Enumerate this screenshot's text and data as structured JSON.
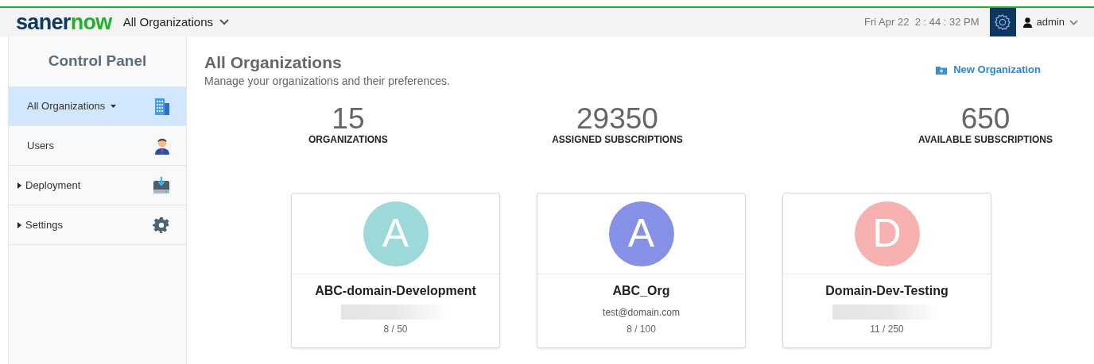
{
  "header": {
    "logo_parts": [
      "saner",
      "now"
    ],
    "org_selector": "All Organizations",
    "datetime": "Fri Apr 22  2 : 44 : 32 PM",
    "user": "admin"
  },
  "sidebar": {
    "title": "Control Panel",
    "items": [
      {
        "label": "All Organizations",
        "kind": "dropdown",
        "selected": true
      },
      {
        "label": "Users",
        "kind": "plain",
        "selected": false
      },
      {
        "label": "Deployment",
        "kind": "collapsed",
        "selected": false
      },
      {
        "label": "Settings",
        "kind": "collapsed",
        "selected": false
      }
    ]
  },
  "page": {
    "title": "All Organizations",
    "subtitle": "Manage your organizations and their preferences.",
    "action": "New Organization"
  },
  "stats": [
    {
      "value": "15",
      "label": "ORGANIZATIONS"
    },
    {
      "value": "29350",
      "label": "ASSIGNED SUBSCRIPTIONS"
    },
    {
      "value": "650",
      "label": "AVAILABLE SUBSCRIPTIONS"
    }
  ],
  "organizations": [
    {
      "letter": "A",
      "color": "#9ed9d9",
      "name": "ABC-domain-Development",
      "email_redacted": true,
      "usage": "8 / 50"
    },
    {
      "letter": "A",
      "color": "#8590e6",
      "name": "ABC_Org",
      "email": "test@domain.com",
      "usage": "8 / 100"
    },
    {
      "letter": "D",
      "color": "#f6b1b0",
      "name": "Domain-Dev-Testing",
      "email_redacted": true,
      "usage": "11 / 250"
    }
  ]
}
